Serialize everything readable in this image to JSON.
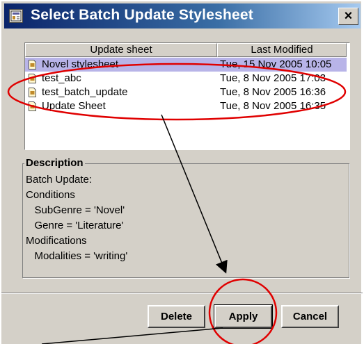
{
  "window": {
    "title": "Select Batch Update Stylesheet",
    "close_label": "×"
  },
  "table": {
    "columns": [
      "Update sheet",
      "Last Modified"
    ],
    "rows": [
      {
        "name": "Novel stylesheet",
        "modified": "Tue, 15 Nov 2005 10:05",
        "selected": true
      },
      {
        "name": "test_abc",
        "modified": "Tue, 8 Nov 2005 17:03",
        "selected": false
      },
      {
        "name": "test_batch_update",
        "modified": "Tue, 8 Nov 2005 16:36",
        "selected": false
      },
      {
        "name": "Update Sheet",
        "modified": "Tue, 8 Nov 2005 16:35",
        "selected": false
      }
    ]
  },
  "description": {
    "title": "Description",
    "lines": [
      "Batch Update:",
      "Conditions",
      "   SubGenre = 'Novel'",
      "   Genre = 'Literature'",
      "Modifications",
      "   Modalities = 'writing'"
    ]
  },
  "buttons": {
    "delete": "Delete",
    "apply": "Apply",
    "cancel": "Cancel"
  },
  "colors": {
    "title_bar_start": "#0a246a",
    "selection": "#b8b4e8",
    "annotation": "#e00000"
  },
  "icons": [
    "stylesheet-icon",
    "document-icon",
    "close-icon"
  ]
}
